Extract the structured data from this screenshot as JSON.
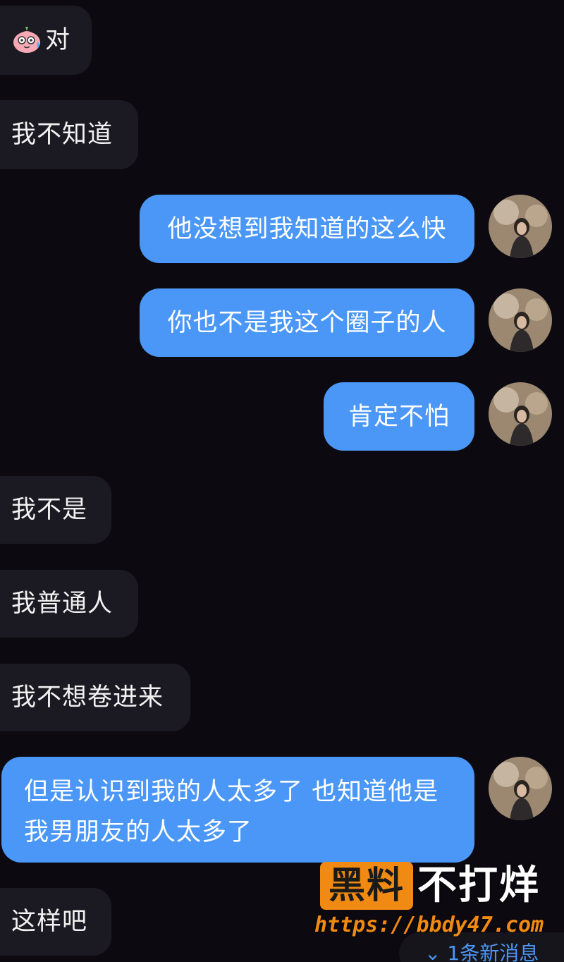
{
  "messages": [
    {
      "side": "in",
      "text": "对",
      "emoji": "sweat-face-icon"
    },
    {
      "side": "in",
      "text": "我不知道"
    },
    {
      "side": "out",
      "text": "他没想到我知道的这么快"
    },
    {
      "side": "out",
      "text": "你也不是我这个圈子的人"
    },
    {
      "side": "out",
      "text": "肯定不怕"
    },
    {
      "side": "in",
      "text": "我不是"
    },
    {
      "side": "in",
      "text": "我普通人"
    },
    {
      "side": "in",
      "text": "我不想卷进来"
    },
    {
      "side": "out",
      "line1": "但是认识到我的人太多了 也知道他是",
      "line2": "我男朋友的人太多了"
    },
    {
      "side": "in",
      "text": "这样吧"
    }
  ],
  "watermark": {
    "box_text": "黑料",
    "title": "不打烊",
    "url": "https://bbdy47.com"
  },
  "new_message_indicator": {
    "icon": "double-chevron-down-icon",
    "text": "1条新消息"
  },
  "colors": {
    "background": "#0c0a10",
    "incoming_bubble": "#1b1a22",
    "outgoing_bubble": "#4a97f7",
    "watermark_accent": "#f08a12"
  }
}
